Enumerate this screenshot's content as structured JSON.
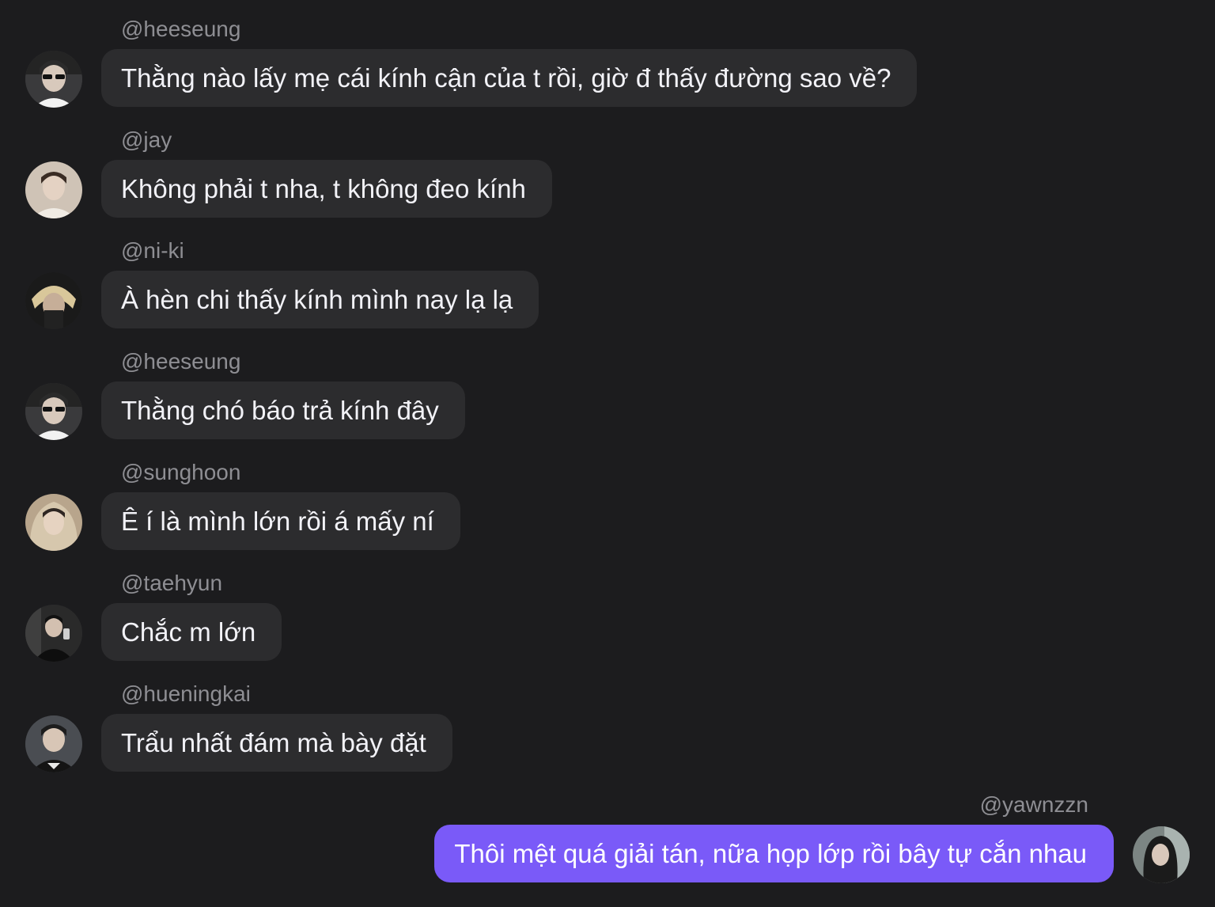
{
  "colors": {
    "background": "#1c1c1e",
    "incoming_bubble": "#2c2c2e",
    "outgoing_bubble": "#7a5af8",
    "username": "#8e8e93",
    "text": "#f2f2f7"
  },
  "messages": [
    {
      "username": "@heeseung",
      "text": "Thằng nào lấy mẹ cái kính cận của t rồi, giờ đ thấy đường sao về?",
      "avatar": "avatar-heeseung"
    },
    {
      "username": "@jay",
      "text": "Không phải t nha, t không đeo kính",
      "avatar": "avatar-jay"
    },
    {
      "username": "@ni-ki",
      "text": "À hèn chi thấy kính mình nay lạ lạ",
      "avatar": "avatar-niki"
    },
    {
      "username": "@heeseung",
      "text": "Thằng chó báo trả kính đây",
      "avatar": "avatar-heeseung"
    },
    {
      "username": "@sunghoon",
      "text": "Ê í là mình lớn rồi á mấy ní",
      "avatar": "avatar-sunghoon"
    },
    {
      "username": "@taehyun",
      "text": "Chắc m lớn",
      "avatar": "avatar-taehyun"
    },
    {
      "username": "@hueningkai",
      "text": "Trẩu nhất đám mà bày đặt",
      "avatar": "avatar-hueningkai"
    },
    {
      "username": "@yawnzzn",
      "text": "Thôi mệt quá giải tán, nữa họp lớp rồi bây tự cắn nhau",
      "avatar": "avatar-yawnzzn",
      "outgoing": true
    }
  ]
}
